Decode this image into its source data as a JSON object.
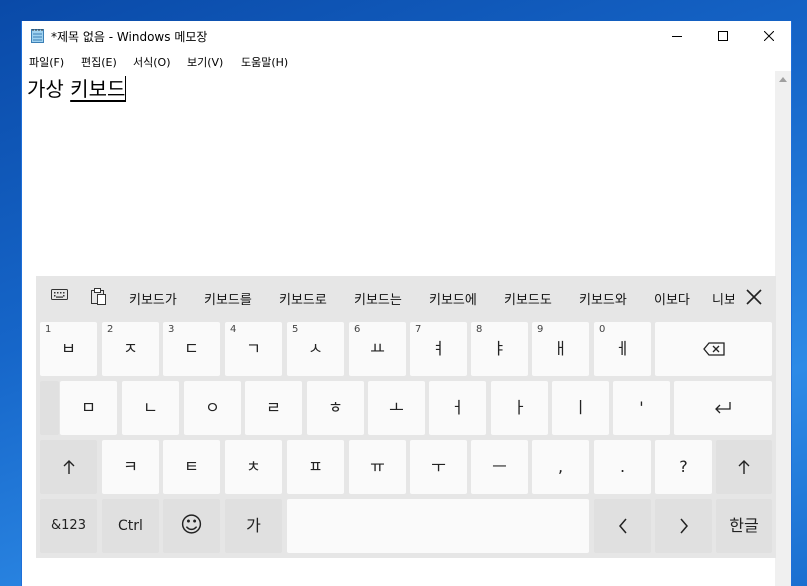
{
  "window": {
    "title": "*제목 없음 - Windows 메모장",
    "menu": [
      "파일(F)",
      "편집(E)",
      "서식(O)",
      "보기(V)",
      "도움말(H)"
    ]
  },
  "editor": {
    "text_committed": "가상 ",
    "text_composing": "키보드"
  },
  "keyboard": {
    "toolbar_icons": [
      "keyboard-settings-icon",
      "clipboard-icon"
    ],
    "suggestions": [
      "키보드가",
      "키보드를",
      "키보드로",
      "키보드는",
      "키보드에",
      "키보드도",
      "키보드와",
      "이보다",
      "니보"
    ],
    "row1": [
      {
        "num": "1",
        "label": "ㅂ"
      },
      {
        "num": "2",
        "label": "ㅈ"
      },
      {
        "num": "3",
        "label": "ㄷ"
      },
      {
        "num": "4",
        "label": "ㄱ"
      },
      {
        "num": "5",
        "label": "ㅅ"
      },
      {
        "num": "6",
        "label": "ㅛ"
      },
      {
        "num": "7",
        "label": "ㅕ"
      },
      {
        "num": "8",
        "label": "ㅑ"
      },
      {
        "num": "9",
        "label": "ㅐ"
      },
      {
        "num": "0",
        "label": "ㅔ"
      }
    ],
    "row2": [
      "ㅁ",
      "ㄴ",
      "ㅇ",
      "ㄹ",
      "ㅎ",
      "ㅗ",
      "ㅓ",
      "ㅏ",
      "ㅣ",
      "'"
    ],
    "row3": [
      "ㅋ",
      "ㅌ",
      "ㅊ",
      "ㅍ",
      "ㅠ",
      "ㅜ",
      "ㅡ",
      ",",
      ".",
      "?"
    ],
    "row4": {
      "symbols": "&123",
      "ctrl": "Ctrl",
      "emoji": "☺",
      "lang_char": "가",
      "hangul_toggle": "한글"
    },
    "icons": {
      "backspace": "backspace-icon",
      "enter": "enter-icon",
      "shift": "shift-up-arrow-icon",
      "left": "chevron-left-icon",
      "right": "chevron-right-icon"
    }
  }
}
